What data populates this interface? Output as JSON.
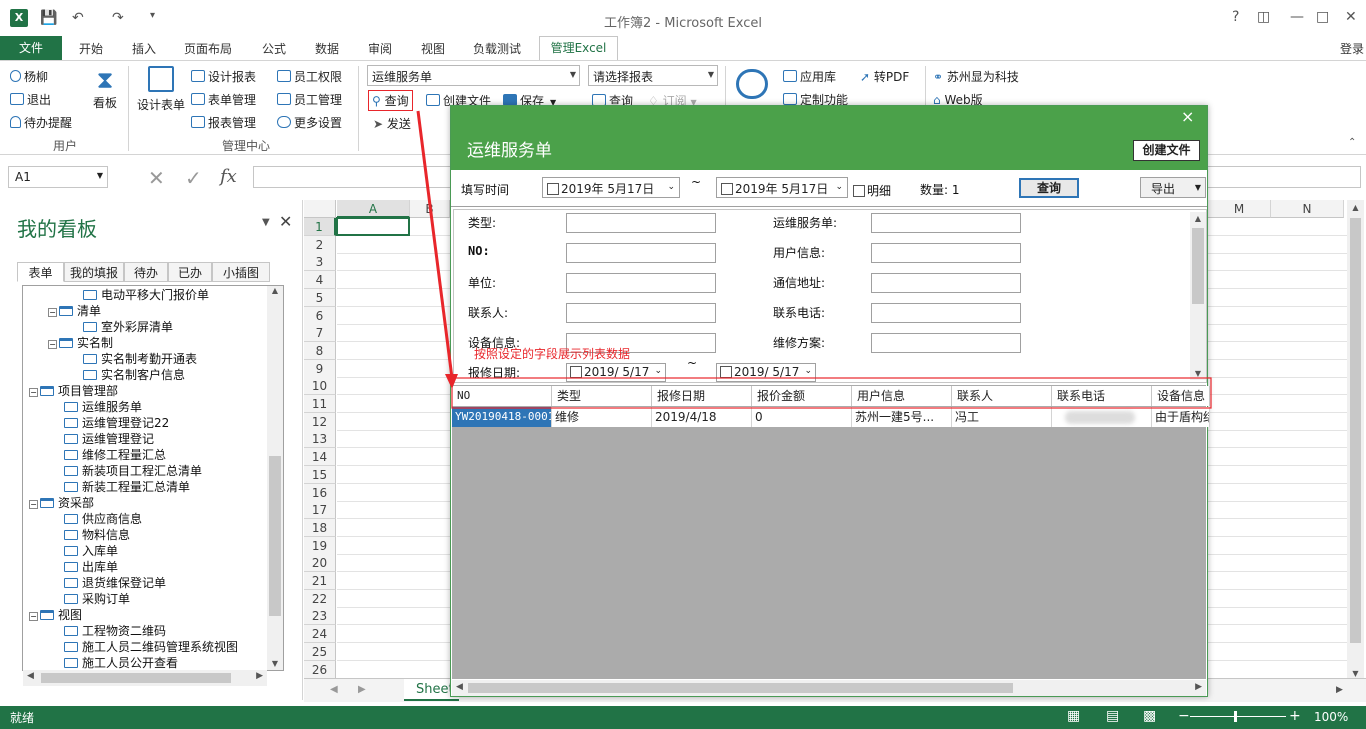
{
  "window": {
    "title": "工作簿2 - Microsoft Excel",
    "help": "?",
    "login": "登录"
  },
  "ribbon_tabs": [
    "文件",
    "开始",
    "插入",
    "页面布局",
    "公式",
    "数据",
    "审阅",
    "视图",
    "负载测试",
    "管理Excel"
  ],
  "ribbon": {
    "user_group": {
      "label": "用户",
      "items": [
        "杨柳",
        "退出",
        "待办提醒"
      ],
      "kanban": "看板"
    },
    "manage_group": {
      "label": "管理中心",
      "design_form": "设计表单",
      "col1": [
        "设计报表",
        "表单管理",
        "报表管理"
      ],
      "col2": [
        "员工权限",
        "员工管理",
        "更多设置"
      ]
    },
    "form_combo": "运维服务单",
    "query": "查询",
    "create_file": "创建文件",
    "save": "保存",
    "send": "发送",
    "report_combo": "请选择报表",
    "report_query": "查询",
    "subscribe": "订阅",
    "app_lib": "应用库",
    "to_pdf": "转PDF",
    "custom": "定制功能",
    "company": "苏州显为科技",
    "web": "Web版"
  },
  "formula_bar": {
    "name_box": "A1",
    "fx": "fx"
  },
  "pane": {
    "title": "我的看板",
    "tabs": [
      "表单",
      "我的填报",
      "待办",
      "已办",
      "小插图"
    ],
    "tree": [
      {
        "label": "电动平移大门报价单",
        "level": 3,
        "kind": "doc"
      },
      {
        "label": "清单",
        "level": 2,
        "kind": "folder"
      },
      {
        "label": "室外彩屏清单",
        "level": 3,
        "kind": "doc"
      },
      {
        "label": "实名制",
        "level": 2,
        "kind": "folder"
      },
      {
        "label": "实名制考勤开通表",
        "level": 3,
        "kind": "doc"
      },
      {
        "label": "实名制客户信息",
        "level": 3,
        "kind": "doc"
      },
      {
        "label": "项目管理部",
        "level": 1,
        "kind": "folder"
      },
      {
        "label": "运维服务单",
        "level": 2,
        "kind": "doc"
      },
      {
        "label": "运维管理登记22",
        "level": 2,
        "kind": "doc"
      },
      {
        "label": "运维管理登记",
        "level": 2,
        "kind": "doc"
      },
      {
        "label": "维修工程量汇总",
        "level": 2,
        "kind": "doc"
      },
      {
        "label": "新装项目工程汇总清单",
        "level": 2,
        "kind": "doc"
      },
      {
        "label": "新装工程量汇总清单",
        "level": 2,
        "kind": "doc"
      },
      {
        "label": "资采部",
        "level": 1,
        "kind": "folder"
      },
      {
        "label": "供应商信息",
        "level": 2,
        "kind": "doc"
      },
      {
        "label": "物料信息",
        "level": 2,
        "kind": "doc"
      },
      {
        "label": "入库单",
        "level": 2,
        "kind": "doc"
      },
      {
        "label": "出库单",
        "level": 2,
        "kind": "doc"
      },
      {
        "label": "退货维保登记单",
        "level": 2,
        "kind": "doc"
      },
      {
        "label": "采购订单",
        "level": 2,
        "kind": "doc"
      },
      {
        "label": "视图",
        "level": 1,
        "kind": "folder"
      },
      {
        "label": "工程物资二维码",
        "level": 2,
        "kind": "view"
      },
      {
        "label": "施工人员二维码管理系统视图",
        "level": 2,
        "kind": "view"
      },
      {
        "label": "施工人员公开查看",
        "level": 2,
        "kind": "view"
      }
    ]
  },
  "sheet": {
    "columns": [
      "A",
      "B",
      "M",
      "N"
    ],
    "rows": [
      "1",
      "2",
      "3",
      "4",
      "5",
      "6",
      "7",
      "8",
      "9",
      "10",
      "11",
      "12",
      "13",
      "14",
      "15",
      "16",
      "17",
      "18",
      "19",
      "20",
      "21",
      "22",
      "23",
      "24",
      "25",
      "26"
    ],
    "tab": "Sheet"
  },
  "dialog": {
    "title": "运维服务单",
    "create_btn": "创建文件",
    "close": "×",
    "fill_time_label": "填写时间",
    "date_from": "2019年 5月17日",
    "date_to": "2019年 5月17日",
    "tilde": "~",
    "detail": "明细",
    "count": "数量: 1",
    "query_btn": "查询",
    "export_btn": "导出",
    "fields_left": [
      "类型:",
      "NO:",
      "单位:",
      "联系人:",
      "设备信息:"
    ],
    "fields_right": [
      "运维服务单:",
      "用户信息:",
      "通信地址:",
      "联系电话:",
      "维修方案:"
    ],
    "repair_date_label": "报修日期:",
    "repair_from": "2019/ 5/17",
    "repair_to": "2019/ 5/17",
    "annotation": "按照设定的字段展示列表数据",
    "grid_headers": [
      "NO",
      "类型",
      "报修日期",
      "报价金额",
      "用户信息",
      "联系人",
      "联系电话",
      "设备信息"
    ],
    "grid_rows": [
      [
        "YW20190418-0001",
        "维修",
        "2019/4/18",
        "0",
        "苏州一建5号...",
        "冯工",
        "",
        "由于盾构结"
      ]
    ]
  },
  "status": {
    "ready": "就绪",
    "zoom": "100%"
  },
  "colors": {
    "excel_green": "#217346",
    "dialog_green": "#4ba14a",
    "annotation_red": "#e8262b"
  }
}
